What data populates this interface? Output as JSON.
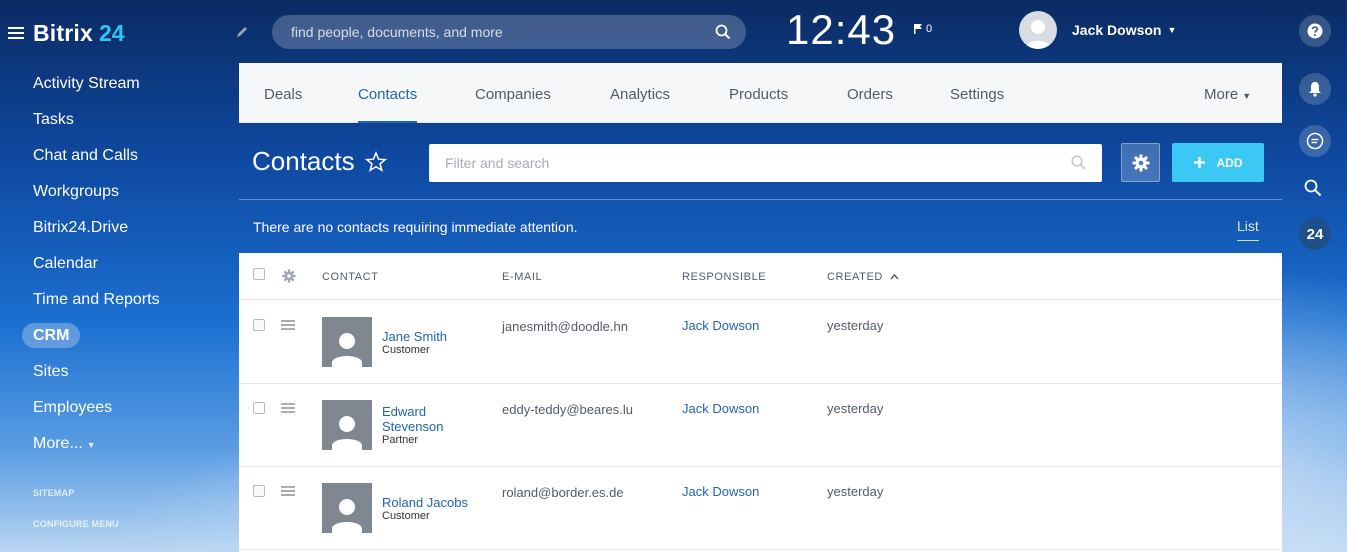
{
  "brand": {
    "name": "Bitrix",
    "number": "24"
  },
  "sidebar": {
    "items": [
      {
        "label": "Activity Stream"
      },
      {
        "label": "Tasks"
      },
      {
        "label": "Chat and Calls"
      },
      {
        "label": "Workgroups"
      },
      {
        "label": "Bitrix24.Drive"
      },
      {
        "label": "Calendar"
      },
      {
        "label": "Time and Reports"
      },
      {
        "label": "CRM"
      },
      {
        "label": "Sites"
      },
      {
        "label": "Employees"
      },
      {
        "label": "More..."
      }
    ],
    "sitemap": "SITEMAP",
    "configure": "CONFIGURE MENU"
  },
  "header": {
    "search_placeholder": "find people, documents, and more",
    "clock": "12:43",
    "flag_count": "0",
    "user_name": "Jack Dowson"
  },
  "tabs": [
    {
      "label": "Deals"
    },
    {
      "label": "Contacts"
    },
    {
      "label": "Companies"
    },
    {
      "label": "Analytics"
    },
    {
      "label": "Products"
    },
    {
      "label": "Orders"
    },
    {
      "label": "Settings"
    },
    {
      "label": "More"
    }
  ],
  "page": {
    "title": "Contacts",
    "filter_placeholder": "Filter and search",
    "add_label": "ADD",
    "attention": "There are no contacts requiring immediate attention.",
    "view_label": "List"
  },
  "grid": {
    "columns": {
      "contact": "CONTACT",
      "email": "E-MAIL",
      "responsible": "RESPONSIBLE",
      "created": "CREATED"
    },
    "rows": [
      {
        "name": "Jane Smith",
        "type": "Customer",
        "email": "janesmith@doodle.hn",
        "responsible": "Jack Dowson",
        "created": "yesterday"
      },
      {
        "name": "Edward Stevenson",
        "type": "Partner",
        "email": "eddy-teddy@beares.lu",
        "responsible": "Jack Dowson",
        "created": "yesterday"
      },
      {
        "name": "Roland Jacobs",
        "type": "Customer",
        "email": "roland@border.es.de",
        "responsible": "Jack Dowson",
        "created": "yesterday"
      }
    ]
  },
  "colors": {
    "accent": "#2067b0",
    "add_button": "#3bc8f5",
    "brand_number": "#2fc6f6"
  }
}
